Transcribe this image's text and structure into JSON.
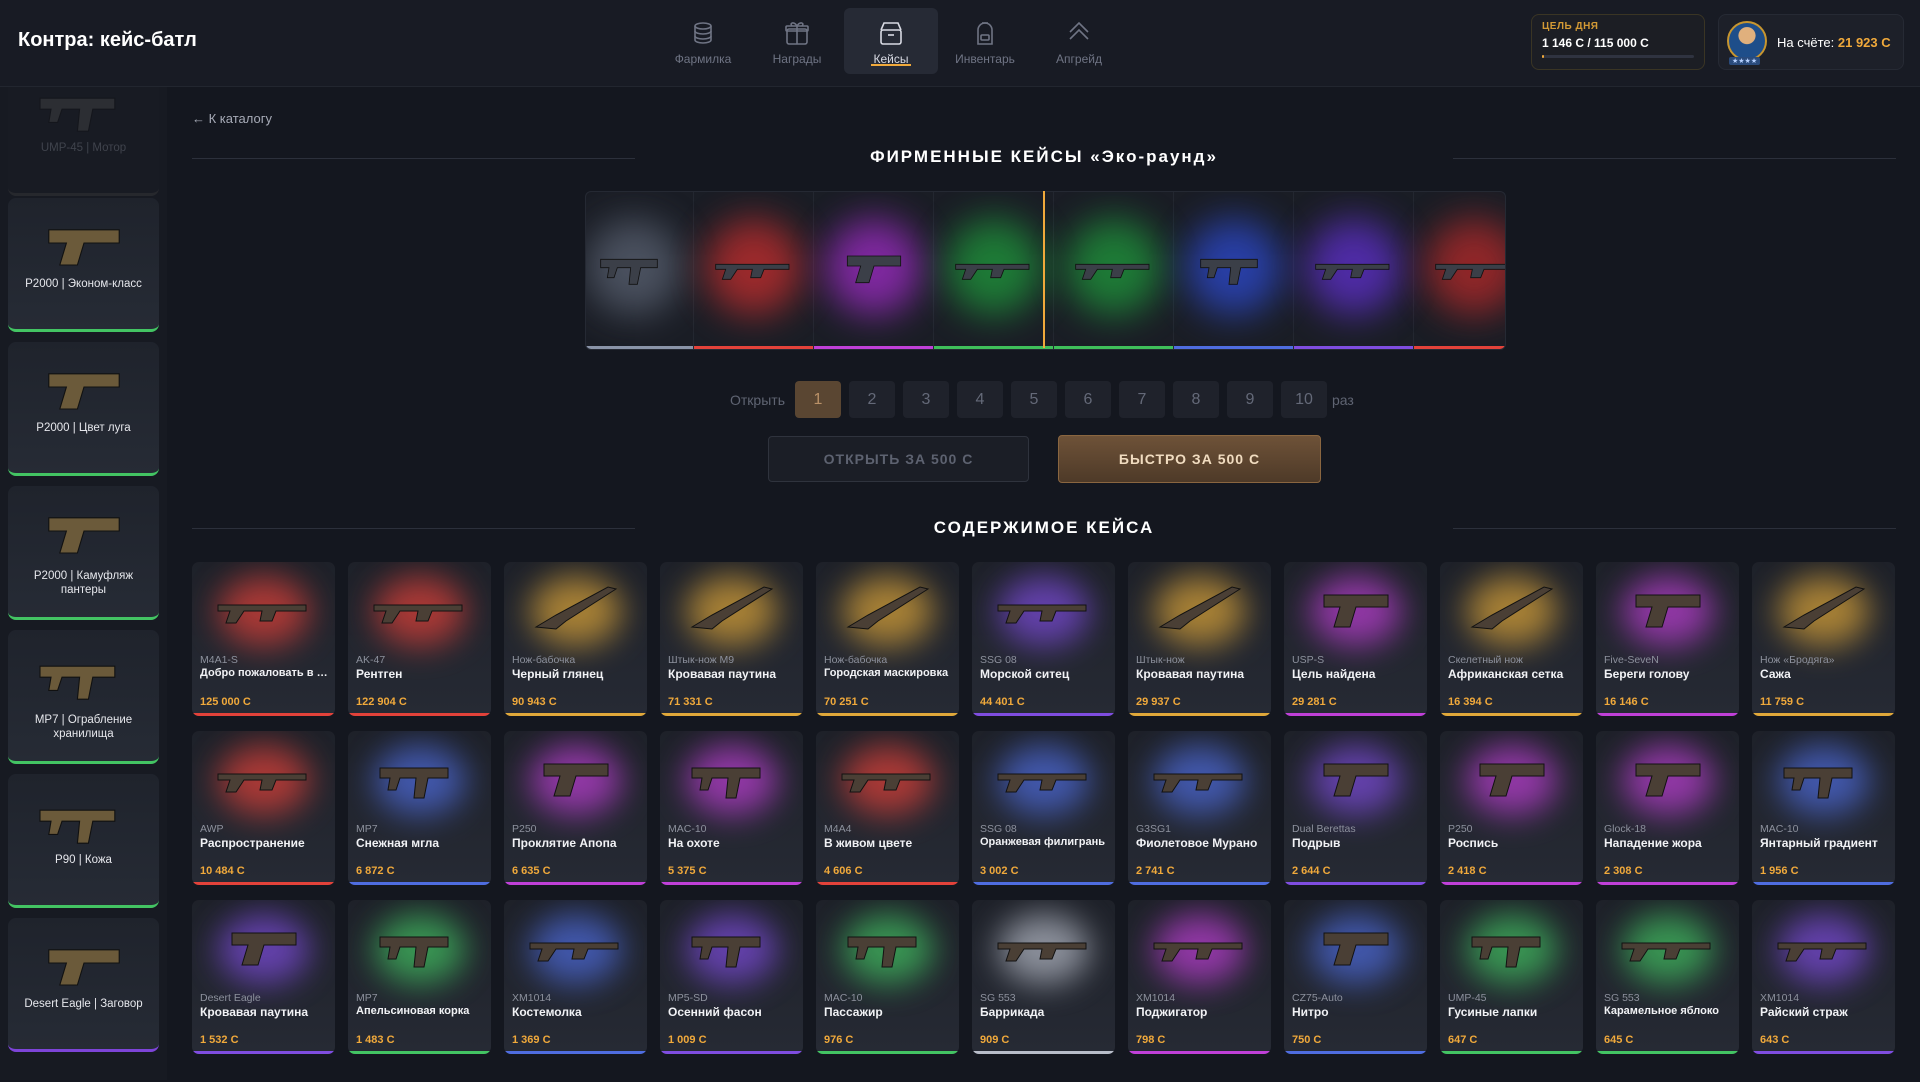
{
  "app": {
    "title": "Контра: кейс-батл"
  },
  "nav": [
    {
      "label": "Фармилка",
      "icon": "coins-icon"
    },
    {
      "label": "Награды",
      "icon": "gift-icon"
    },
    {
      "label": "Кейсы",
      "icon": "case-icon",
      "active": true
    },
    {
      "label": "Инвентарь",
      "icon": "backpack-icon"
    },
    {
      "label": "Апгрейд",
      "icon": "upgrade-icon"
    }
  ],
  "goal": {
    "label": "ЦЕЛЬ ДНЯ",
    "value": "1 146 С / 115 000 С",
    "progress": 0.01
  },
  "account": {
    "label": "На счёте:",
    "balance": "21 923 С"
  },
  "sidebar": [
    {
      "name": "UMP-45 | Мотор",
      "color": "#444",
      "faded": true
    },
    {
      "name": "P2000 | Эконом-класс",
      "color": "#43c463"
    },
    {
      "name": "P2000 | Цвет луга",
      "color": "#43c463"
    },
    {
      "name": "P2000 | Камуфляж пантеры",
      "color": "#43c463"
    },
    {
      "name": "MP7 | Ограбление хранилища",
      "color": "#43c463"
    },
    {
      "name": "P90 | Кожа",
      "color": "#43c463"
    },
    {
      "name": "Desert Eagle | Заговор",
      "color": "#7d44d8"
    }
  ],
  "back_link": "← К каталогу",
  "case_title": "ФИРМЕННЫЕ КЕЙСЫ «Эко-раунд»",
  "roulette": [
    {
      "color": "#8a94a8",
      "glow": "#5a6272"
    },
    {
      "color": "#e3423a",
      "glow": "#c72e2e"
    },
    {
      "color": "#c040d8",
      "glow": "#a02cc8"
    },
    {
      "color": "#3fbf5a",
      "glow": "#1f9a3c"
    },
    {
      "color": "#3fbf5a",
      "glow": "#1f9a3c"
    },
    {
      "color": "#4f6de0",
      "glow": "#2d4ad0"
    },
    {
      "color": "#7f4de0",
      "glow": "#6030d0"
    },
    {
      "color": "#e3423a",
      "glow": "#b72a2a"
    }
  ],
  "open": {
    "label": "Открыть",
    "counts": [
      "1",
      "2",
      "3",
      "4",
      "5",
      "6",
      "7",
      "8",
      "9",
      "10"
    ],
    "selected": 0,
    "suffix": "раз",
    "open_button": "ОТКРЫТЬ ЗА 500 С",
    "fast_button": "БЫСТРО ЗА 500 С"
  },
  "contents_title": "СОДЕРЖИМОЕ КЕЙСА",
  "items": [
    {
      "type": "M4A1-S",
      "name": "Добро пожаловать в джунгли",
      "price": "125 000 С",
      "color": "#e3423a"
    },
    {
      "type": "AK-47",
      "name": "Рентген",
      "price": "122 904 С",
      "color": "#e3423a"
    },
    {
      "type": "Нож-бабочка",
      "name": "Черный глянец",
      "price": "90 943 С",
      "color": "#e0a83a"
    },
    {
      "type": "Штык-нож M9",
      "name": "Кровавая паутина",
      "price": "71 331 С",
      "color": "#e0a83a"
    },
    {
      "type": "Нож-бабочка",
      "name": "Городская маскировка",
      "price": "70 251 С",
      "color": "#e0a83a"
    },
    {
      "type": "SSG 08",
      "name": "Морской ситец",
      "price": "44 401 С",
      "color": "#7f4de0"
    },
    {
      "type": "Штык-нож",
      "name": "Кровавая паутина",
      "price": "29 937 С",
      "color": "#e0a83a"
    },
    {
      "type": "USP-S",
      "name": "Цель найдена",
      "price": "29 281 С",
      "color": "#c040d8"
    },
    {
      "type": "Скелетный нож",
      "name": "Африканская сетка",
      "price": "16 394 С",
      "color": "#e0a83a"
    },
    {
      "type": "Five-SeveN",
      "name": "Береги голову",
      "price": "16 146 С",
      "color": "#c040d8"
    },
    {
      "type": "Нож «Бродяга»",
      "name": "Сажа",
      "price": "11 759 С",
      "color": "#e0a83a"
    },
    {
      "type": "AWP",
      "name": "Распространение",
      "price": "10 484 С",
      "color": "#e3423a"
    },
    {
      "type": "MP7",
      "name": "Снежная мгла",
      "price": "6 872 С",
      "color": "#4f6de0"
    },
    {
      "type": "P250",
      "name": "Проклятие Апопа",
      "price": "6 635 С",
      "color": "#c040d8"
    },
    {
      "type": "MAC-10",
      "name": "На охоте",
      "price": "5 375 С",
      "color": "#c040d8"
    },
    {
      "type": "M4A4",
      "name": "В живом цвете",
      "price": "4 606 С",
      "color": "#e3423a"
    },
    {
      "type": "SSG 08",
      "name": "Оранжевая филигрань",
      "price": "3 002 С",
      "color": "#4f6de0"
    },
    {
      "type": "G3SG1",
      "name": "Фиолетовое Мурано",
      "price": "2 741 С",
      "color": "#4f6de0"
    },
    {
      "type": "Dual Berettas",
      "name": "Подрыв",
      "price": "2 644 С",
      "color": "#7f4de0"
    },
    {
      "type": "P250",
      "name": "Роспись",
      "price": "2 418 С",
      "color": "#c040d8"
    },
    {
      "type": "Glock-18",
      "name": "Нападение жора",
      "price": "2 308 С",
      "color": "#c040d8"
    },
    {
      "type": "MAC-10",
      "name": "Янтарный градиент",
      "price": "1 956 С",
      "color": "#4f6de0"
    },
    {
      "type": "Desert Eagle",
      "name": "Кровавая паутина",
      "price": "1 532 С",
      "color": "#7f4de0"
    },
    {
      "type": "MP7",
      "name": "Апельсиновая корка",
      "price": "1 483 С",
      "color": "#43c463"
    },
    {
      "type": "XM1014",
      "name": "Костемолка",
      "price": "1 369 С",
      "color": "#4f6de0"
    },
    {
      "type": "MP5-SD",
      "name": "Осенний фасон",
      "price": "1 009 С",
      "color": "#7f4de0"
    },
    {
      "type": "MAC-10",
      "name": "Пассажир",
      "price": "976 С",
      "color": "#43c463"
    },
    {
      "type": "SG 553",
      "name": "Баррикада",
      "price": "909 С",
      "color": "#b8bdc9"
    },
    {
      "type": "XM1014",
      "name": "Поджигатор",
      "price": "798 С",
      "color": "#c040d8"
    },
    {
      "type": "CZ75-Auto",
      "name": "Нитро",
      "price": "750 С",
      "color": "#4f6de0"
    },
    {
      "type": "UMP-45",
      "name": "Гусиные лапки",
      "price": "647 С",
      "color": "#43c463"
    },
    {
      "type": "SG 553",
      "name": "Карамельное яблоко",
      "price": "645 С",
      "color": "#43c463"
    },
    {
      "type": "XM1014",
      "name": "Райский страж",
      "price": "643 С",
      "color": "#7f4de0"
    }
  ]
}
